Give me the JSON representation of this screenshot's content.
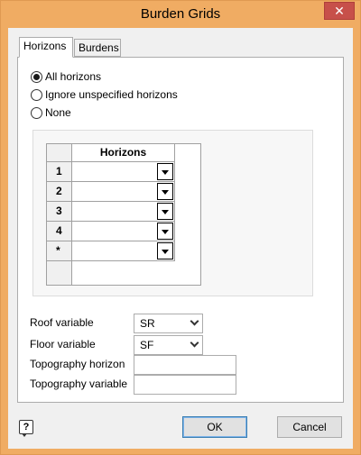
{
  "window": {
    "title": "Burden Grids",
    "close_label": "✕"
  },
  "tabs": [
    {
      "label": "Horizons",
      "active": true
    },
    {
      "label": "Burdens",
      "active": false
    }
  ],
  "horizon_mode": {
    "options": [
      {
        "label": "All horizons",
        "checked": true
      },
      {
        "label": "Ignore unspecified horizons",
        "checked": false
      },
      {
        "label": "None",
        "checked": false
      }
    ]
  },
  "grid": {
    "column_header": "Horizons",
    "rows": [
      {
        "label": "1",
        "value": ""
      },
      {
        "label": "2",
        "value": ""
      },
      {
        "label": "3",
        "value": ""
      },
      {
        "label": "4",
        "value": ""
      },
      {
        "label": "*",
        "value": ""
      }
    ]
  },
  "form": {
    "roof_label": "Roof variable",
    "roof_value": "SR",
    "floor_label": "Floor variable",
    "floor_value": "SF",
    "topo_horizon_label": "Topography horizon",
    "topo_horizon_value": "",
    "topo_variable_label": "Topography variable",
    "topo_variable_value": ""
  },
  "footer": {
    "help_glyph": "?",
    "ok_label": "OK",
    "cancel_label": "Cancel"
  },
  "icons": {
    "help": "help-icon",
    "close": "close-icon",
    "dropdown": "chevron-down-icon"
  }
}
